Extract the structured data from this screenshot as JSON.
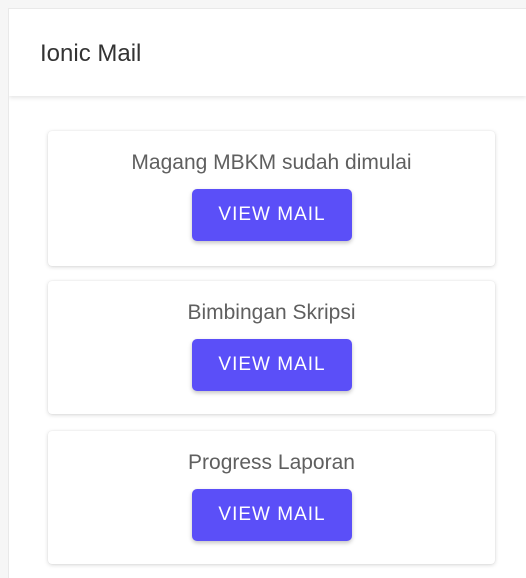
{
  "header": {
    "title": "Ionic Mail"
  },
  "mails": [
    {
      "subject": "Magang MBKM sudah dimulai",
      "button_label": "VIEW MAIL"
    },
    {
      "subject": "Bimbingan Skripsi",
      "button_label": "VIEW MAIL"
    },
    {
      "subject": "Progress Laporan",
      "button_label": "VIEW MAIL"
    }
  ],
  "colors": {
    "accent": "#5b4ff8",
    "background": "#ffffff",
    "card_text": "#5f5f5f"
  }
}
